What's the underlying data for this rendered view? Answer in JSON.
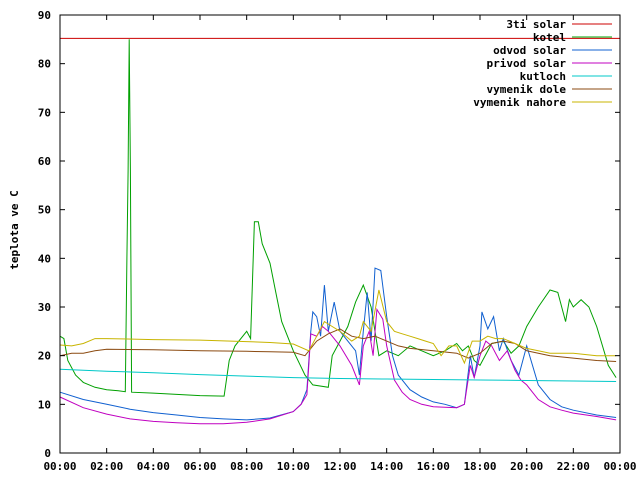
{
  "chart_data": {
    "type": "line",
    "title": "",
    "xlabel": "",
    "ylabel": "teplota ve C",
    "xlim": [
      "00:00",
      "24:00"
    ],
    "ylim": [
      0,
      90
    ],
    "grid": false,
    "legend_position": "top-right",
    "x_ticks": [
      "00:00",
      "02:00",
      "04:00",
      "06:00",
      "08:00",
      "10:00",
      "12:00",
      "14:00",
      "16:00",
      "18:00",
      "20:00",
      "22:00",
      "00:00"
    ],
    "y_ticks": [
      0,
      10,
      20,
      30,
      40,
      50,
      60,
      70,
      80,
      90
    ],
    "series": [
      {
        "name": "3ti solar",
        "color": "#cc0000",
        "points": [
          [
            "00:00",
            85.2
          ],
          [
            "24:00",
            85.2
          ]
        ]
      },
      {
        "name": "kotel",
        "color": "#00a000",
        "points": [
          [
            "00:00",
            24
          ],
          [
            "00:10",
            23.5
          ],
          [
            "00:20",
            19
          ],
          [
            "00:40",
            16
          ],
          [
            "01:00",
            14.5
          ],
          [
            "01:30",
            13.5
          ],
          [
            "02:00",
            13
          ],
          [
            "02:30",
            12.8
          ],
          [
            "02:48",
            12.6
          ],
          [
            "02:52",
            40
          ],
          [
            "02:55",
            58
          ],
          [
            "02:58",
            85
          ],
          [
            "03:01",
            58
          ],
          [
            "03:04",
            12.5
          ],
          [
            "04:00",
            12.3
          ],
          [
            "06:00",
            11.8
          ],
          [
            "07:02",
            11.7
          ],
          [
            "07:15",
            19
          ],
          [
            "07:30",
            22
          ],
          [
            "08:00",
            25
          ],
          [
            "08:10",
            23.5
          ],
          [
            "08:20",
            47.5
          ],
          [
            "08:30",
            47.5
          ],
          [
            "08:40",
            43
          ],
          [
            "09:00",
            39
          ],
          [
            "09:15",
            33
          ],
          [
            "09:30",
            27
          ],
          [
            "09:45",
            24
          ],
          [
            "10:00",
            21
          ],
          [
            "10:30",
            16
          ],
          [
            "10:50",
            14
          ],
          [
            "11:30",
            13.5
          ],
          [
            "11:40",
            20
          ],
          [
            "12:00",
            23
          ],
          [
            "12:20",
            26
          ],
          [
            "12:40",
            31
          ],
          [
            "13:00",
            34.5
          ],
          [
            "13:20",
            30
          ],
          [
            "13:40",
            20
          ],
          [
            "14:00",
            21
          ],
          [
            "14:30",
            20
          ],
          [
            "15:00",
            22
          ],
          [
            "15:30",
            21
          ],
          [
            "16:00",
            20
          ],
          [
            "16:30",
            21
          ],
          [
            "17:00",
            22.5
          ],
          [
            "17:15",
            21
          ],
          [
            "17:30",
            22
          ],
          [
            "17:45",
            19
          ],
          [
            "18:00",
            18
          ],
          [
            "18:30",
            22.5
          ],
          [
            "19:00",
            23
          ],
          [
            "19:20",
            20.5
          ],
          [
            "19:40",
            22
          ],
          [
            "20:00",
            26
          ],
          [
            "20:30",
            30
          ],
          [
            "21:00",
            33.5
          ],
          [
            "21:20",
            33
          ],
          [
            "21:40",
            27
          ],
          [
            "21:50",
            31.5
          ],
          [
            "22:00",
            30
          ],
          [
            "22:20",
            31.5
          ],
          [
            "22:40",
            30
          ],
          [
            "23:00",
            26
          ],
          [
            "23:30",
            18
          ],
          [
            "23:50",
            15.5
          ]
        ]
      },
      {
        "name": "odvod solar",
        "color": "#1060d0",
        "points": [
          [
            "00:00",
            12.5
          ],
          [
            "01:00",
            11
          ],
          [
            "02:00",
            10
          ],
          [
            "03:00",
            9
          ],
          [
            "04:00",
            8.3
          ],
          [
            "05:00",
            7.8
          ],
          [
            "06:00",
            7.3
          ],
          [
            "07:00",
            7
          ],
          [
            "08:00",
            6.8
          ],
          [
            "09:00",
            7.2
          ],
          [
            "10:00",
            8.5
          ],
          [
            "10:20",
            10
          ],
          [
            "10:35",
            13
          ],
          [
            "10:45",
            25
          ],
          [
            "10:50",
            29
          ],
          [
            "11:00",
            28
          ],
          [
            "11:10",
            24
          ],
          [
            "11:20",
            34.5
          ],
          [
            "11:30",
            25
          ],
          [
            "11:45",
            31
          ],
          [
            "12:00",
            25
          ],
          [
            "12:20",
            23
          ],
          [
            "12:40",
            21
          ],
          [
            "12:50",
            16
          ],
          [
            "13:00",
            25
          ],
          [
            "13:10",
            33
          ],
          [
            "13:20",
            23
          ],
          [
            "13:30",
            38
          ],
          [
            "13:45",
            37.5
          ],
          [
            "14:00",
            28
          ],
          [
            "14:15",
            20
          ],
          [
            "14:30",
            16
          ],
          [
            "15:00",
            13
          ],
          [
            "15:30",
            11.5
          ],
          [
            "16:00",
            10.5
          ],
          [
            "16:30",
            10
          ],
          [
            "17:00",
            9.3
          ],
          [
            "17:20",
            10
          ],
          [
            "17:35",
            20
          ],
          [
            "17:45",
            15.5
          ],
          [
            "18:00",
            22
          ],
          [
            "18:05",
            29
          ],
          [
            "18:20",
            25.5
          ],
          [
            "18:35",
            28
          ],
          [
            "18:50",
            21
          ],
          [
            "19:00",
            23.5
          ],
          [
            "19:20",
            19
          ],
          [
            "19:40",
            16
          ],
          [
            "20:00",
            22
          ],
          [
            "20:30",
            14
          ],
          [
            "21:00",
            11
          ],
          [
            "21:30",
            9.5
          ],
          [
            "22:00",
            8.8
          ],
          [
            "23:00",
            7.8
          ],
          [
            "23:50",
            7.3
          ]
        ]
      },
      {
        "name": "privod solar",
        "color": "#c000c0",
        "points": [
          [
            "00:00",
            11.5
          ],
          [
            "01:00",
            9.3
          ],
          [
            "02:00",
            8
          ],
          [
            "03:00",
            7
          ],
          [
            "04:00",
            6.5
          ],
          [
            "05:00",
            6.2
          ],
          [
            "06:00",
            6
          ],
          [
            "07:00",
            6
          ],
          [
            "08:00",
            6.3
          ],
          [
            "09:00",
            7
          ],
          [
            "10:00",
            8.5
          ],
          [
            "10:20",
            10
          ],
          [
            "10:35",
            12
          ],
          [
            "10:45",
            24.5
          ],
          [
            "11:00",
            24
          ],
          [
            "11:15",
            26
          ],
          [
            "11:30",
            25
          ],
          [
            "12:00",
            22
          ],
          [
            "12:30",
            18
          ],
          [
            "12:50",
            14
          ],
          [
            "13:00",
            22
          ],
          [
            "13:15",
            25
          ],
          [
            "13:25",
            20
          ],
          [
            "13:35",
            29.5
          ],
          [
            "13:50",
            27.5
          ],
          [
            "14:00",
            22
          ],
          [
            "14:20",
            15
          ],
          [
            "14:40",
            12.5
          ],
          [
            "15:00",
            11
          ],
          [
            "15:30",
            10
          ],
          [
            "16:00",
            9.5
          ],
          [
            "17:00",
            9.3
          ],
          [
            "17:20",
            10
          ],
          [
            "17:35",
            18
          ],
          [
            "17:45",
            15.5
          ],
          [
            "18:00",
            20
          ],
          [
            "18:15",
            23
          ],
          [
            "18:30",
            22
          ],
          [
            "18:50",
            19
          ],
          [
            "19:10",
            21
          ],
          [
            "19:30",
            17
          ],
          [
            "19:45",
            15
          ],
          [
            "20:00",
            14
          ],
          [
            "20:30",
            11
          ],
          [
            "21:00",
            9.5
          ],
          [
            "21:30",
            8.8
          ],
          [
            "22:00",
            8.2
          ],
          [
            "23:00",
            7.5
          ],
          [
            "23:50",
            6.8
          ]
        ]
      },
      {
        "name": "kutloch",
        "color": "#00c8c8",
        "points": [
          [
            "00:00",
            17.2
          ],
          [
            "02:00",
            16.8
          ],
          [
            "04:00",
            16.5
          ],
          [
            "06:00",
            16.1
          ],
          [
            "08:00",
            15.8
          ],
          [
            "10:00",
            15.5
          ],
          [
            "12:00",
            15.3
          ],
          [
            "14:00",
            15.2
          ],
          [
            "16:00",
            15.1
          ],
          [
            "18:00",
            15
          ],
          [
            "20:00",
            14.9
          ],
          [
            "22:00",
            14.8
          ],
          [
            "23:50",
            14.7
          ]
        ]
      },
      {
        "name": "vymenik dole",
        "color": "#8b4a10",
        "points": [
          [
            "00:00",
            20
          ],
          [
            "00:30",
            20.5
          ],
          [
            "01:00",
            20.5
          ],
          [
            "01:30",
            21
          ],
          [
            "02:00",
            21.3
          ],
          [
            "04:00",
            21.2
          ],
          [
            "06:00",
            21
          ],
          [
            "08:00",
            20.9
          ],
          [
            "09:00",
            20.8
          ],
          [
            "10:00",
            20.7
          ],
          [
            "10:30",
            20
          ],
          [
            "11:00",
            23
          ],
          [
            "11:30",
            24.5
          ],
          [
            "12:00",
            25.5
          ],
          [
            "12:30",
            24
          ],
          [
            "13:00",
            23.5
          ],
          [
            "13:30",
            24
          ],
          [
            "14:00",
            23
          ],
          [
            "14:30",
            22
          ],
          [
            "15:00",
            21.5
          ],
          [
            "16:00",
            21
          ],
          [
            "17:00",
            20.5
          ],
          [
            "17:30",
            19.5
          ],
          [
            "18:00",
            20.5
          ],
          [
            "18:30",
            22.5
          ],
          [
            "19:00",
            23
          ],
          [
            "19:30",
            22.5
          ],
          [
            "20:00",
            21
          ],
          [
            "21:00",
            20
          ],
          [
            "22:00",
            19.5
          ],
          [
            "23:00",
            19
          ],
          [
            "23:50",
            18.8
          ]
        ]
      },
      {
        "name": "vymenik nahore",
        "color": "#c8b400",
        "points": [
          [
            "00:00",
            22.2
          ],
          [
            "00:30",
            22
          ],
          [
            "01:00",
            22.5
          ],
          [
            "01:30",
            23.5
          ],
          [
            "02:00",
            23.5
          ],
          [
            "04:00",
            23.3
          ],
          [
            "06:00",
            23.2
          ],
          [
            "08:00",
            22.9
          ],
          [
            "09:00",
            22.7
          ],
          [
            "10:00",
            22.4
          ],
          [
            "10:40",
            21
          ],
          [
            "11:00",
            24
          ],
          [
            "11:20",
            27
          ],
          [
            "11:40",
            26
          ],
          [
            "12:00",
            25
          ],
          [
            "12:30",
            23
          ],
          [
            "12:50",
            24
          ],
          [
            "13:00",
            27
          ],
          [
            "13:20",
            25
          ],
          [
            "13:40",
            33.5
          ],
          [
            "14:00",
            27
          ],
          [
            "14:20",
            25
          ],
          [
            "14:40",
            24.5
          ],
          [
            "15:00",
            24
          ],
          [
            "15:20",
            23.5
          ],
          [
            "15:40",
            23
          ],
          [
            "16:00",
            22.5
          ],
          [
            "16:20",
            20
          ],
          [
            "16:40",
            22
          ],
          [
            "17:00",
            22
          ],
          [
            "17:20",
            18.5
          ],
          [
            "17:40",
            23
          ],
          [
            "18:00",
            23
          ],
          [
            "18:20",
            24
          ],
          [
            "18:40",
            23.5
          ],
          [
            "19:00",
            23.5
          ],
          [
            "19:30",
            22.5
          ],
          [
            "20:00",
            21.5
          ],
          [
            "20:30",
            21
          ],
          [
            "21:00",
            20.5
          ],
          [
            "22:00",
            20.5
          ],
          [
            "23:00",
            20
          ],
          [
            "23:50",
            20
          ]
        ]
      }
    ]
  }
}
